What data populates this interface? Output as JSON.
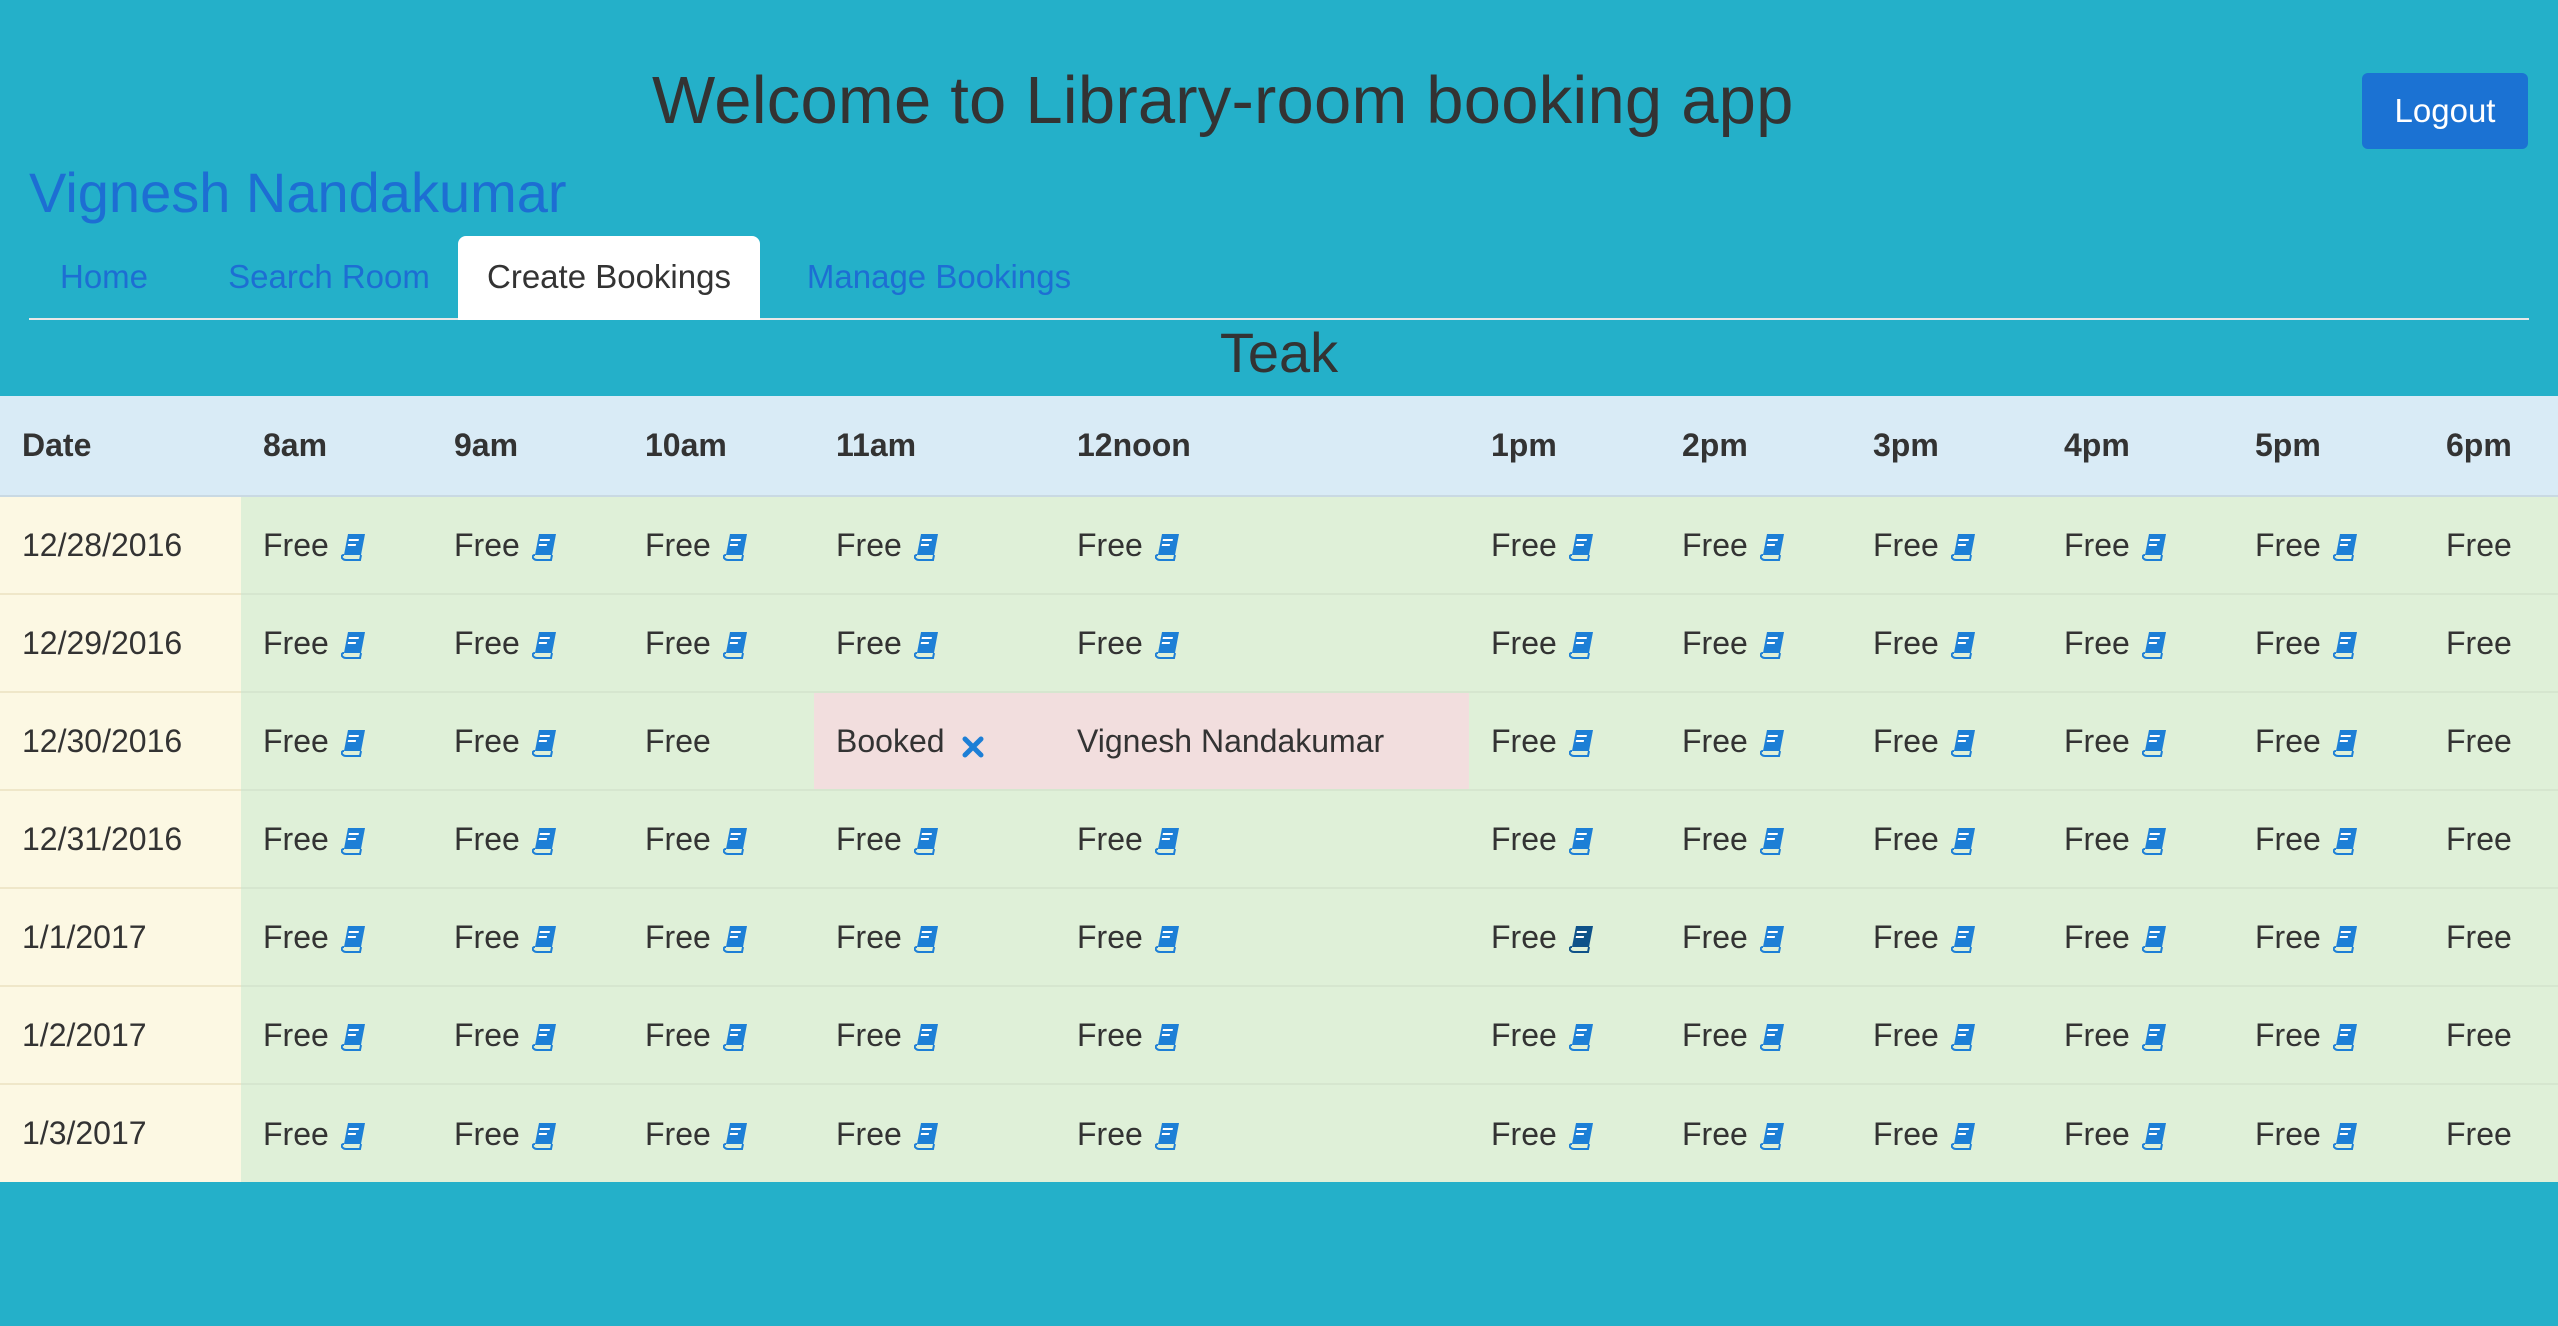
{
  "header": {
    "title": "Welcome to Library-room booking app",
    "logout_label": "Logout",
    "user_name": "Vignesh Nandakumar"
  },
  "nav": {
    "tabs": [
      {
        "label": "Home",
        "active": false
      },
      {
        "label": "Search Room",
        "active": false
      },
      {
        "label": "Create Bookings",
        "active": true
      },
      {
        "label": "Manage Bookings",
        "active": false
      }
    ]
  },
  "room": {
    "name": "Teak"
  },
  "colors": {
    "background": "#24b0c9",
    "link": "#1d6ed3",
    "button": "#1b72d3",
    "free_cell": "#dff0d8",
    "booked_cell": "#f2dede",
    "date_cell": "#fcf8e3",
    "header_row": "#d9ebf6",
    "icon": "#1d7fd6",
    "icon_highlight": "#0f5289"
  },
  "schedule": {
    "headers": [
      "Date",
      "8am",
      "9am",
      "10am",
      "11am",
      "12noon",
      "1pm",
      "2pm",
      "3pm",
      "4pm",
      "5pm",
      "6pm"
    ],
    "rows": [
      {
        "date": "12/28/2016",
        "slots": [
          {
            "status": "Free",
            "icon": "book-icon"
          },
          {
            "status": "Free",
            "icon": "book-icon"
          },
          {
            "status": "Free",
            "icon": "book-icon"
          },
          {
            "status": "Free",
            "icon": "book-icon"
          },
          {
            "status": "Free",
            "icon": "book-icon"
          },
          {
            "status": "Free",
            "icon": "book-icon"
          },
          {
            "status": "Free",
            "icon": "book-icon"
          },
          {
            "status": "Free",
            "icon": "book-icon"
          },
          {
            "status": "Free",
            "icon": "book-icon"
          },
          {
            "status": "Free",
            "icon": "book-icon"
          },
          {
            "status": "Free",
            "icon": null
          }
        ]
      },
      {
        "date": "12/29/2016",
        "slots": [
          {
            "status": "Free",
            "icon": "book-icon"
          },
          {
            "status": "Free",
            "icon": "book-icon"
          },
          {
            "status": "Free",
            "icon": "book-icon"
          },
          {
            "status": "Free",
            "icon": "book-icon"
          },
          {
            "status": "Free",
            "icon": "book-icon"
          },
          {
            "status": "Free",
            "icon": "book-icon"
          },
          {
            "status": "Free",
            "icon": "book-icon"
          },
          {
            "status": "Free",
            "icon": "book-icon"
          },
          {
            "status": "Free",
            "icon": "book-icon"
          },
          {
            "status": "Free",
            "icon": "book-icon"
          },
          {
            "status": "Free",
            "icon": null
          }
        ]
      },
      {
        "date": "12/30/2016",
        "slots": [
          {
            "status": "Free",
            "icon": "book-icon"
          },
          {
            "status": "Free",
            "icon": "book-icon"
          },
          {
            "status": "Free",
            "icon": null
          },
          {
            "status": "Booked",
            "icon": "cancel-icon",
            "booked": true
          },
          {
            "status": "Vignesh Nandakumar",
            "icon": null,
            "booked": true
          },
          {
            "status": "Free",
            "icon": "book-icon"
          },
          {
            "status": "Free",
            "icon": "book-icon"
          },
          {
            "status": "Free",
            "icon": "book-icon"
          },
          {
            "status": "Free",
            "icon": "book-icon"
          },
          {
            "status": "Free",
            "icon": "book-icon"
          },
          {
            "status": "Free",
            "icon": null
          }
        ]
      },
      {
        "date": "12/31/2016",
        "slots": [
          {
            "status": "Free",
            "icon": "book-icon"
          },
          {
            "status": "Free",
            "icon": "book-icon"
          },
          {
            "status": "Free",
            "icon": "book-icon"
          },
          {
            "status": "Free",
            "icon": "book-icon"
          },
          {
            "status": "Free",
            "icon": "book-icon"
          },
          {
            "status": "Free",
            "icon": "book-icon"
          },
          {
            "status": "Free",
            "icon": "book-icon"
          },
          {
            "status": "Free",
            "icon": "book-icon"
          },
          {
            "status": "Free",
            "icon": "book-icon"
          },
          {
            "status": "Free",
            "icon": "book-icon"
          },
          {
            "status": "Free",
            "icon": null
          }
        ]
      },
      {
        "date": "1/1/2017",
        "slots": [
          {
            "status": "Free",
            "icon": "book-icon"
          },
          {
            "status": "Free",
            "icon": "book-icon"
          },
          {
            "status": "Free",
            "icon": "book-icon"
          },
          {
            "status": "Free",
            "icon": "book-icon"
          },
          {
            "status": "Free",
            "icon": "book-icon"
          },
          {
            "status": "Free",
            "icon": "book-icon",
            "highlight": true
          },
          {
            "status": "Free",
            "icon": "book-icon"
          },
          {
            "status": "Free",
            "icon": "book-icon"
          },
          {
            "status": "Free",
            "icon": "book-icon"
          },
          {
            "status": "Free",
            "icon": "book-icon"
          },
          {
            "status": "Free",
            "icon": null
          }
        ]
      },
      {
        "date": "1/2/2017",
        "slots": [
          {
            "status": "Free",
            "icon": "book-icon"
          },
          {
            "status": "Free",
            "icon": "book-icon"
          },
          {
            "status": "Free",
            "icon": "book-icon"
          },
          {
            "status": "Free",
            "icon": "book-icon"
          },
          {
            "status": "Free",
            "icon": "book-icon"
          },
          {
            "status": "Free",
            "icon": "book-icon"
          },
          {
            "status": "Free",
            "icon": "book-icon"
          },
          {
            "status": "Free",
            "icon": "book-icon"
          },
          {
            "status": "Free",
            "icon": "book-icon"
          },
          {
            "status": "Free",
            "icon": "book-icon"
          },
          {
            "status": "Free",
            "icon": null
          }
        ]
      },
      {
        "date": "1/3/2017",
        "slots": [
          {
            "status": "Free",
            "icon": "book-icon"
          },
          {
            "status": "Free",
            "icon": "book-icon"
          },
          {
            "status": "Free",
            "icon": "book-icon"
          },
          {
            "status": "Free",
            "icon": "book-icon"
          },
          {
            "status": "Free",
            "icon": "book-icon"
          },
          {
            "status": "Free",
            "icon": "book-icon"
          },
          {
            "status": "Free",
            "icon": "book-icon"
          },
          {
            "status": "Free",
            "icon": "book-icon"
          },
          {
            "status": "Free",
            "icon": "book-icon"
          },
          {
            "status": "Free",
            "icon": "book-icon"
          },
          {
            "status": "Free",
            "icon": null
          }
        ]
      }
    ]
  }
}
